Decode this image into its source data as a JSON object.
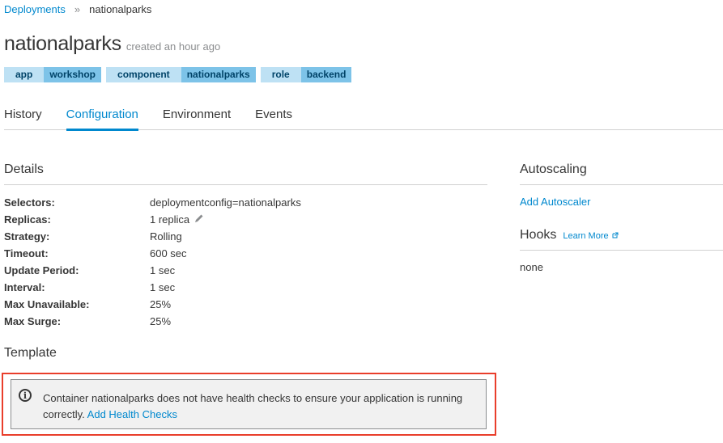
{
  "breadcrumb": {
    "parent": "Deployments",
    "separator": "»",
    "current": "nationalparks"
  },
  "header": {
    "title": "nationalparks",
    "created": "created an hour ago"
  },
  "labels": [
    {
      "key": "app",
      "value": "workshop"
    },
    {
      "key": "component",
      "value": "nationalparks"
    },
    {
      "key": "role",
      "value": "backend"
    }
  ],
  "tabs": [
    {
      "label": "History"
    },
    {
      "label": "Configuration"
    },
    {
      "label": "Environment"
    },
    {
      "label": "Events"
    }
  ],
  "active_tab": "Configuration",
  "details": {
    "heading": "Details",
    "rows": [
      {
        "key": "Selectors:",
        "value": "deploymentconfig=nationalparks"
      },
      {
        "key": "Replicas:",
        "value": "1 replica"
      },
      {
        "key": "Strategy:",
        "value": "Rolling"
      },
      {
        "key": "Timeout:",
        "value": "600 sec"
      },
      {
        "key": "Update Period:",
        "value": "1 sec"
      },
      {
        "key": "Interval:",
        "value": "1 sec"
      },
      {
        "key": "Max Unavailable:",
        "value": "25%"
      },
      {
        "key": "Max Surge:",
        "value": "25%"
      }
    ]
  },
  "template": {
    "heading": "Template"
  },
  "alert": {
    "message": "Container nationalparks does not have health checks to ensure your application is running correctly.",
    "link": "Add Health Checks"
  },
  "autoscaling": {
    "heading": "Autoscaling",
    "link": "Add Autoscaler"
  },
  "hooks": {
    "heading": "Hooks",
    "learn_more": "Learn More",
    "value": "none"
  },
  "colors": {
    "accent": "#0088ce",
    "label_key_bg": "#bee1f4",
    "label_value_bg": "#7dc3e8",
    "highlight": "#e93e2b"
  },
  "icons": {
    "separator": "chevron-right-double",
    "edit": "pencil-icon",
    "external": "external-link-icon",
    "info": "info-circle-icon"
  }
}
